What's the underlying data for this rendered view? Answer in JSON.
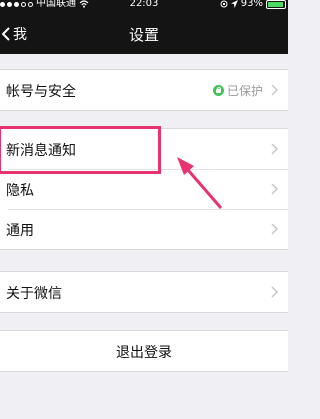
{
  "status_bar": {
    "carrier": "中国联通",
    "time": "22:03",
    "battery": "93%",
    "battery_level": 0.93
  },
  "nav": {
    "back_label": "我",
    "title": "设置"
  },
  "groups": [
    {
      "items": [
        {
          "label": "帐号与安全",
          "status": "已保护"
        }
      ]
    },
    {
      "items": [
        {
          "label": "新消息通知"
        },
        {
          "label": "隐私"
        },
        {
          "label": "通用"
        }
      ]
    },
    {
      "items": [
        {
          "label": "关于微信"
        }
      ]
    },
    {
      "items": [
        {
          "label": "退出登录"
        }
      ]
    }
  ],
  "colors": {
    "highlight": "#e8336e",
    "protect_badge": "#44c25a",
    "bar_background": "#141414",
    "page_background": "#efeff4"
  }
}
